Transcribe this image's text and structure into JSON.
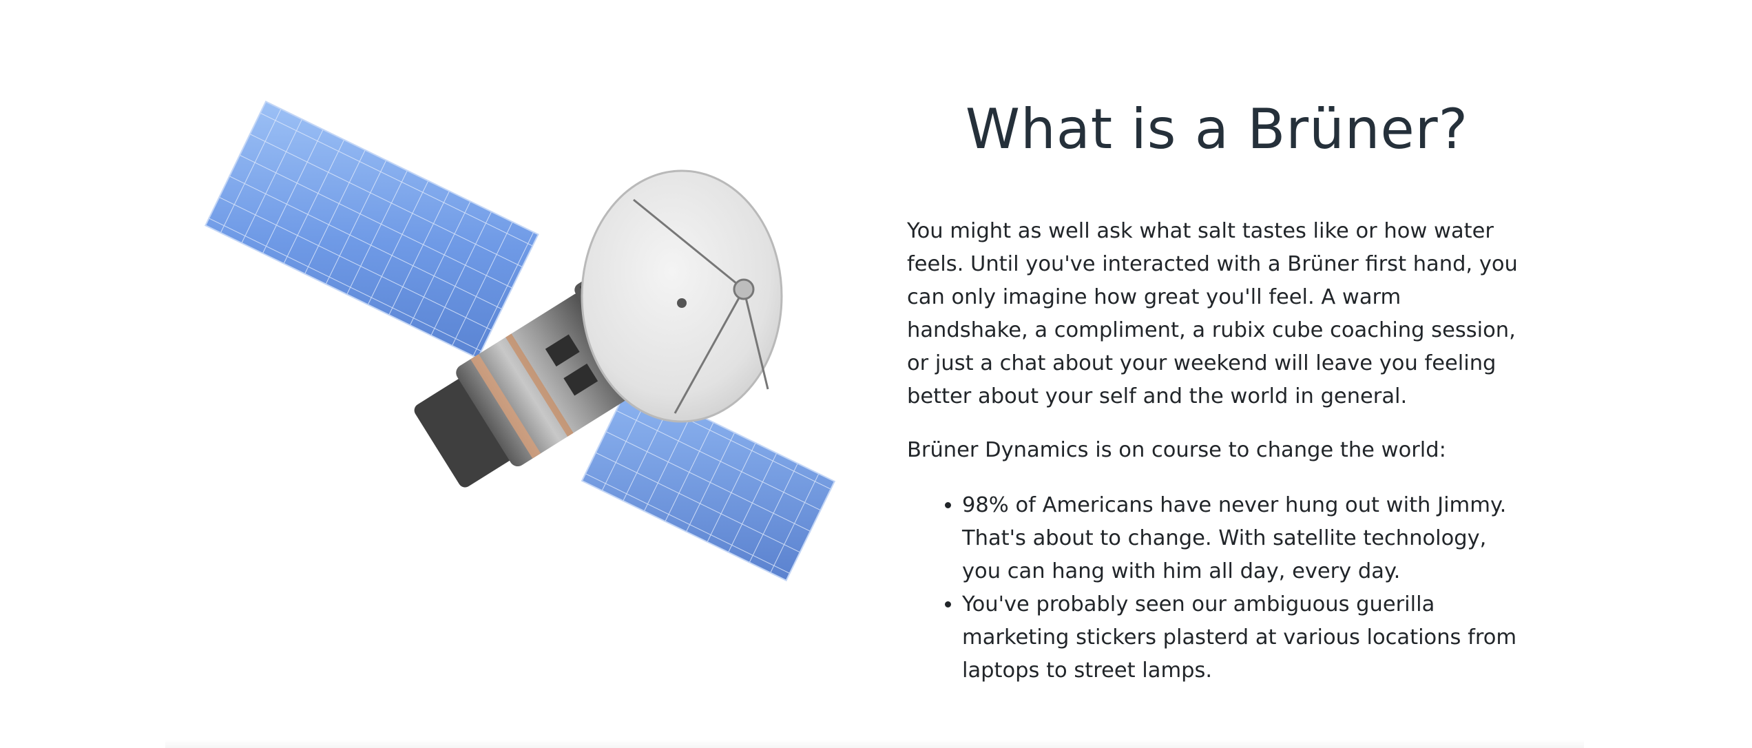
{
  "about": {
    "heading": "What is a Brüner?",
    "intro": "You might as well ask what salt tastes like or how water feels. Until you've interacted with a Brüner first hand, you can only imagine how great you'll feel. A warm handshake, a compliment, a rubix cube coaching session, or just a chat about your weekend will leave you feeling better about your self and the world in general.",
    "mission": "Brüner Dynamics is on course to change the world:",
    "bullets": [
      "98% of Americans have never hung out with Jimmy. That's about to change. With satellite technology, you can hang with him all day, every day.",
      "You've probably seen our ambiguous guerilla marketing stickers plasterd at various locations from laptops to street lamps."
    ]
  },
  "image": {
    "icon": "satellite-icon",
    "panel_color": "#7fa8ec",
    "body_color": "#8c8c8c",
    "dish_color": "#e9e9e9"
  }
}
